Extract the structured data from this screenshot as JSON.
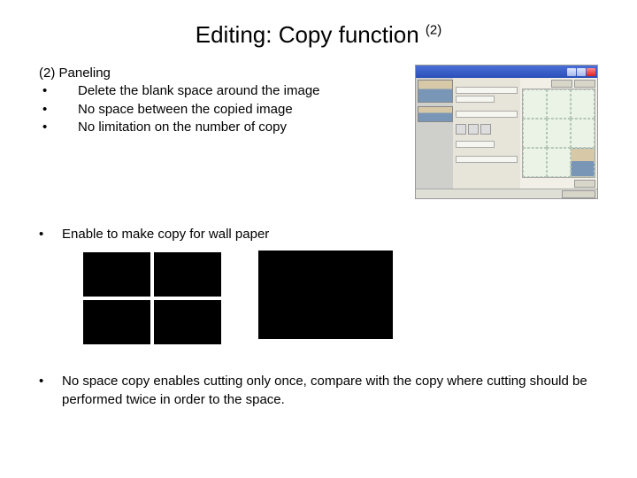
{
  "title_main": "Editing: Copy function ",
  "title_sup": "(2)",
  "heading": "(2) Paneling",
  "sub_bullets": [
    "Delete the blank space around the image",
    "No space between the copied image",
    "No limitation on the number of copy"
  ],
  "bullet_mid": "Enable to make copy for wall paper",
  "bullet_bottom": "No space copy enables cutting only once, compare with the copy where cutting should be performed twice in order to the space."
}
